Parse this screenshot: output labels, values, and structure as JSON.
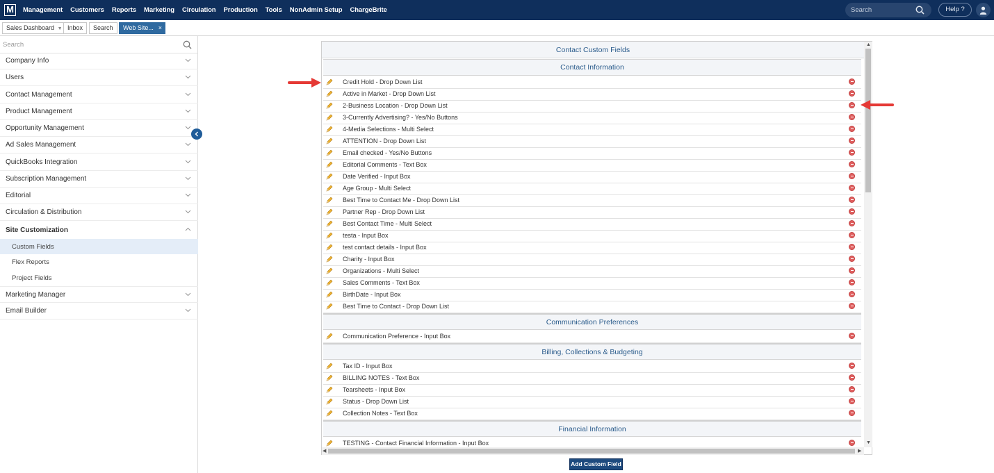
{
  "app": {
    "logo": "M"
  },
  "nav": [
    "Management",
    "Customers",
    "Reports",
    "Marketing",
    "Circulation",
    "Production",
    "Tools",
    "NonAdmin Setup",
    "ChargeBrite"
  ],
  "top_search": {
    "placeholder": "Search"
  },
  "help": {
    "label": "Help ?"
  },
  "tabs": {
    "sales_dashboard": "Sales Dashboard",
    "inbox": "Inbox",
    "search": "Search",
    "website": "Web Site...",
    "close": "×"
  },
  "sidebar": {
    "search_placeholder": "Search",
    "items": [
      "Company Info",
      "Users",
      "Contact Management",
      "Product Management",
      "Opportunity Management",
      "Ad Sales Management",
      "QuickBooks Integration",
      "Subscription Management",
      "Editorial",
      "Circulation & Distribution",
      "Site Customization"
    ],
    "sub_items": [
      "Custom Fields",
      "Flex Reports",
      "Project Fields"
    ],
    "items_after": [
      "Marketing Manager",
      "Email Builder"
    ]
  },
  "panel": {
    "title": "Contact Custom Fields",
    "sections": [
      {
        "title": "Contact Information",
        "fields": [
          "Credit Hold - Drop Down List",
          "Active in Market - Drop Down List",
          "2-Business Location - Drop Down List",
          "3-Currently Advertising? - Yes/No Buttons",
          "4-Media Selections - Multi Select",
          "ATTENTION - Drop Down List",
          "Email checked - Yes/No Buttons",
          "Editorial Comments - Text Box",
          "Date Verified - Input Box",
          "Age Group - Multi Select",
          "Best Time to Contact Me - Drop Down List",
          "Partner Rep - Drop Down List",
          "Best Contact Time - Multi Select",
          "testa - Input Box",
          "test contact details - Input Box",
          "Charity - Input Box",
          "Organizations - Multi Select",
          "Sales Comments - Text Box",
          "BirthDate - Input Box",
          "Best Time to Contact - Drop Down List"
        ]
      },
      {
        "title": "Communication Preferences",
        "fields": [
          "Communication Preference - Input Box"
        ]
      },
      {
        "title": "Billing, Collections & Budgeting",
        "fields": [
          "Tax ID - Input Box",
          "BILLING NOTES - Text Box",
          "Tearsheets - Input Box",
          "Status - Drop Down List",
          "Collection Notes - Text Box"
        ]
      },
      {
        "title": "Financial Information",
        "fields": [
          "TESTING - Contact Financial Information - Input Box"
        ]
      }
    ]
  },
  "add_button": {
    "label": "Add Custom Field"
  },
  "colors": {
    "nav_bg": "#0f2f5c",
    "accent": "#2f6aa0",
    "annotation_arrow": "#e53935"
  }
}
